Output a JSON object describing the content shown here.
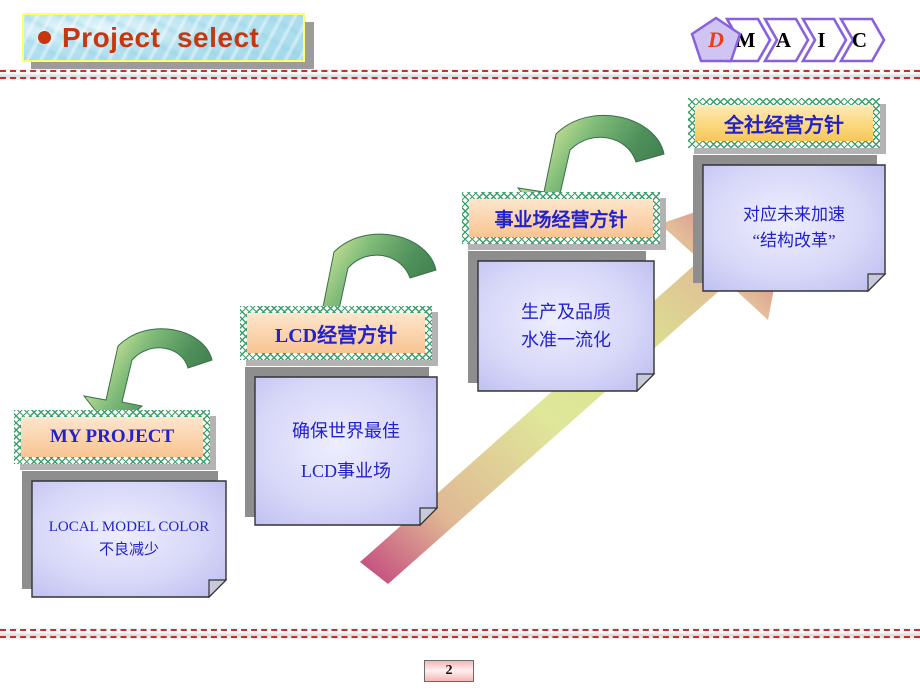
{
  "slide": {
    "page_number": "2",
    "accent_red": "#c8360f",
    "text_blue": "#2222cc",
    "tag_green": "#3aa06a"
  },
  "header": {
    "bullet_icon": "bullet-dot-icon",
    "title": "Project  select",
    "phases": [
      {
        "label": "D",
        "shape": "pentagon",
        "active": true
      },
      {
        "label": "M",
        "shape": "chevron",
        "active": false
      },
      {
        "label": "A",
        "shape": "chevron",
        "active": false
      },
      {
        "label": "I",
        "shape": "chevron",
        "active": false
      },
      {
        "label": "C",
        "shape": "chevron",
        "active": false
      }
    ]
  },
  "diagram": {
    "growth_arrow": {
      "name": "growth-arrow",
      "gradient_stops": [
        "#c2417e",
        "#d6c98f",
        "#d9e58f",
        "#e0b894",
        "#c2417e"
      ]
    },
    "steps": [
      {
        "tag": "MY PROJECT",
        "tag_style": "peach",
        "lines": [
          "LOCAL  MODEL  COLOR",
          "不良减少"
        ],
        "arrow": "curved-arrow-down-left"
      },
      {
        "tag": "LCD经营方针",
        "tag_style": "peach",
        "lines": [
          "确保世界最佳",
          "LCD事业场"
        ],
        "arrow": "curved-arrow-down-left"
      },
      {
        "tag": "事业场经营方针",
        "tag_style": "peach",
        "lines": [
          "生产及品质",
          "水准一流化"
        ],
        "arrow": "curved-arrow-down-left"
      },
      {
        "tag": "全社经营方针",
        "tag_style": "gold",
        "lines": [
          "对应未来加速",
          "“结构改革”"
        ],
        "arrow": null
      }
    ]
  }
}
